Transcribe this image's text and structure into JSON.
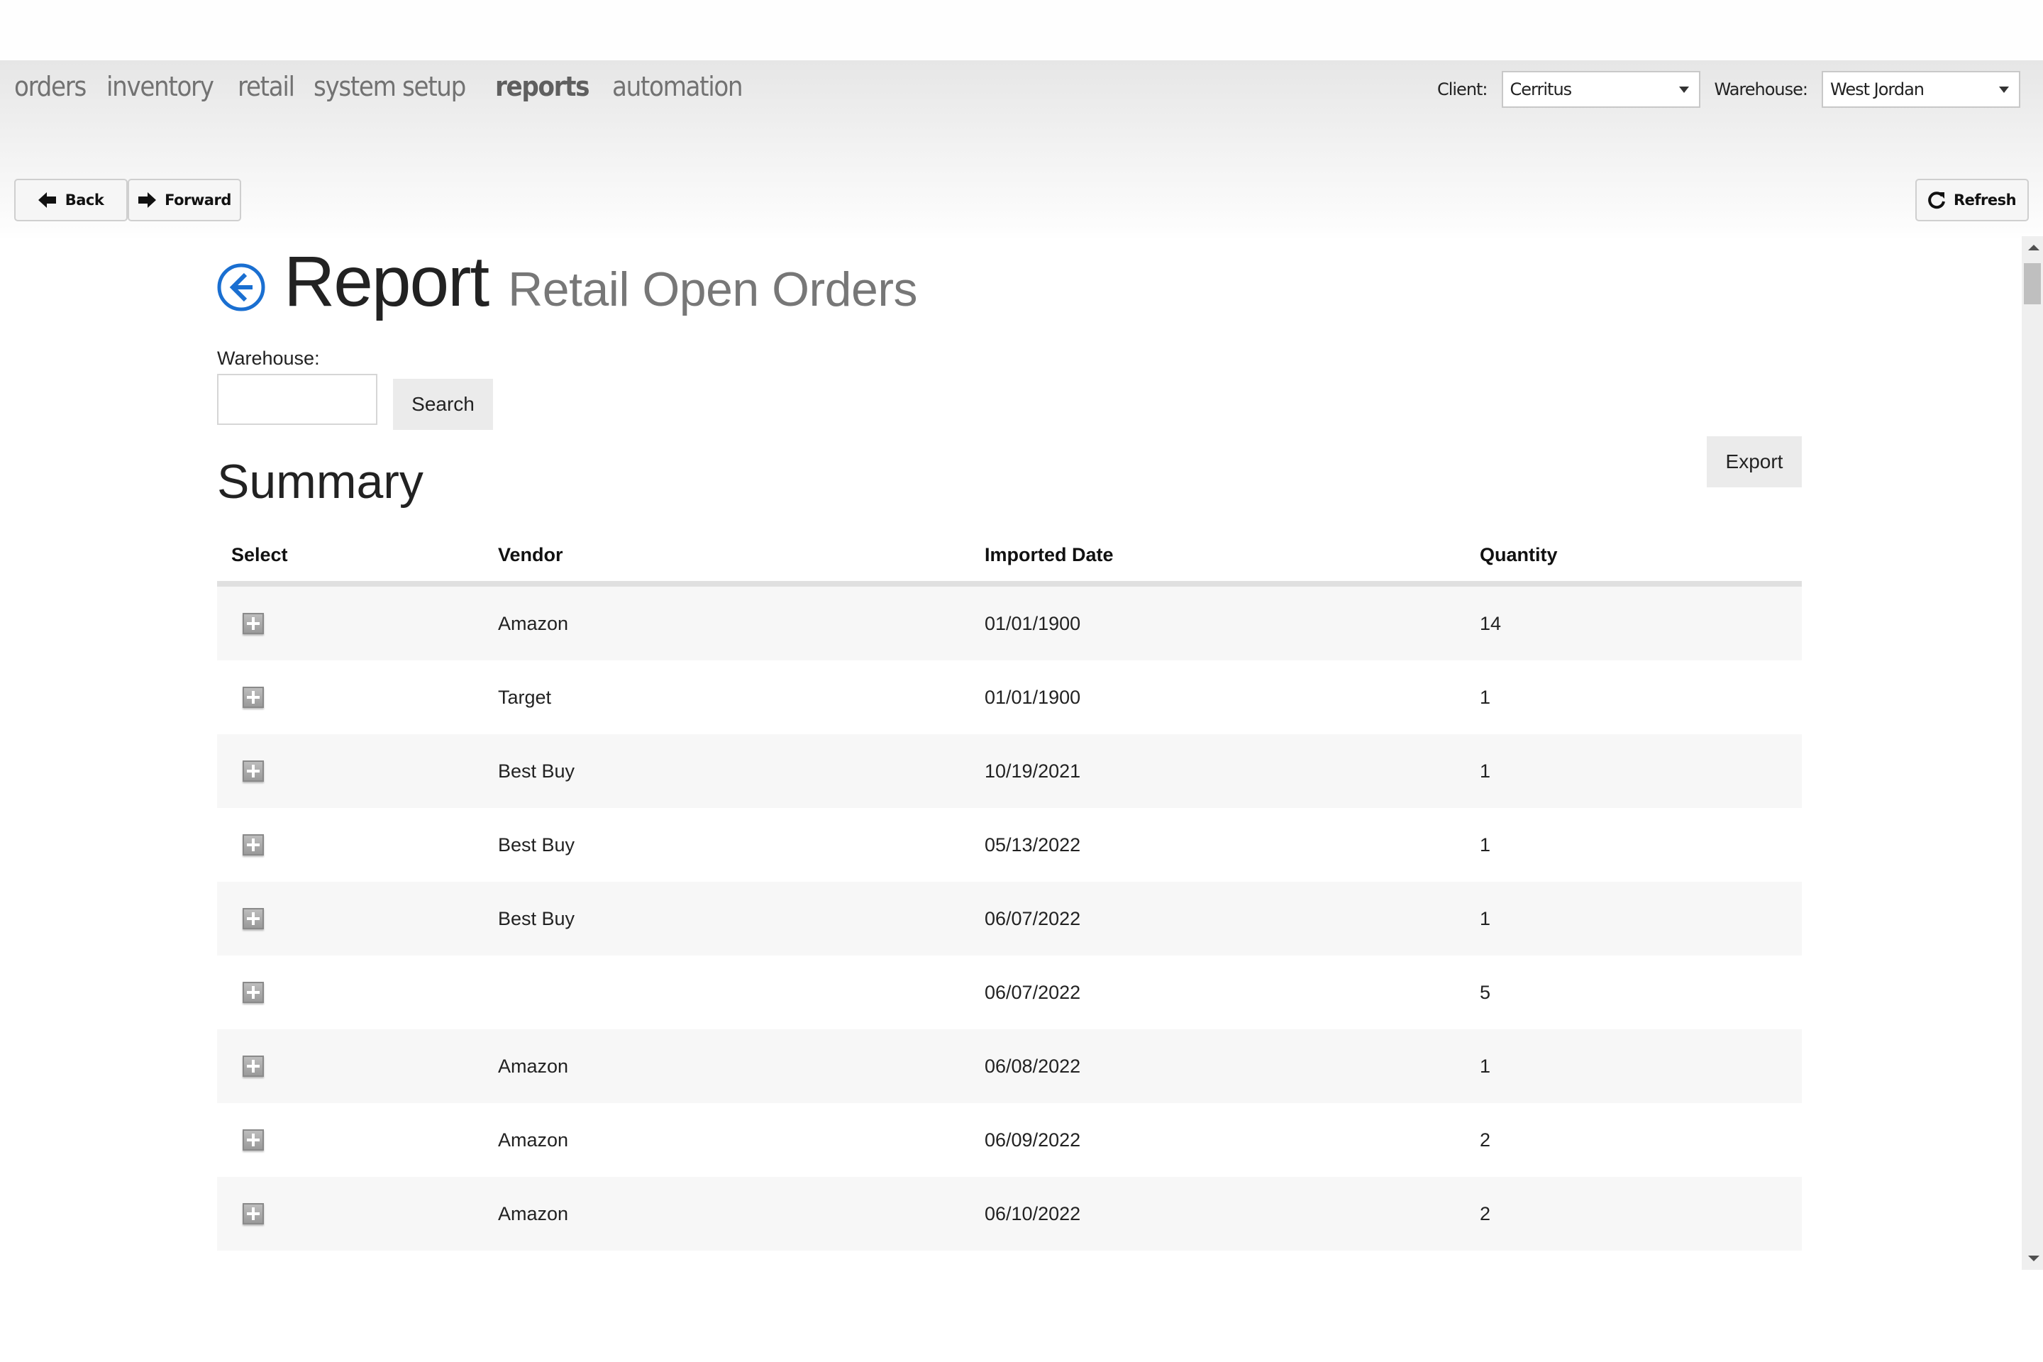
{
  "nav": {
    "items": [
      {
        "label": "orders",
        "active": false
      },
      {
        "label": "inventory",
        "active": false
      },
      {
        "label": "retail",
        "active": false
      },
      {
        "label": "system setup",
        "active": false
      },
      {
        "label": "reports",
        "active": true
      },
      {
        "label": "automation",
        "active": false
      }
    ]
  },
  "selectors": {
    "client_label": "Client:",
    "client_value": "Cerritus",
    "warehouse_label": "Warehouse:",
    "warehouse_value": "West Jordan"
  },
  "toolbar": {
    "back_label": "Back",
    "forward_label": "Forward",
    "refresh_label": "Refresh"
  },
  "page": {
    "title": "Report",
    "subtitle": "Retail Open Orders",
    "accent_color": "#1a6fd1",
    "filter_label": "Warehouse:",
    "filter_value": "",
    "search_label": "Search",
    "export_label": "Export",
    "section_title": "Summary"
  },
  "table": {
    "columns": [
      "Select",
      "Vendor",
      "Imported Date",
      "Quantity"
    ],
    "rows": [
      {
        "vendor": "Amazon",
        "date": "01/01/1900",
        "quantity": "14"
      },
      {
        "vendor": "Target",
        "date": "01/01/1900",
        "quantity": "1"
      },
      {
        "vendor": "Best Buy",
        "date": "10/19/2021",
        "quantity": "1"
      },
      {
        "vendor": "Best Buy",
        "date": "05/13/2022",
        "quantity": "1"
      },
      {
        "vendor": "Best Buy",
        "date": "06/07/2022",
        "quantity": "1"
      },
      {
        "vendor": "",
        "date": "06/07/2022",
        "quantity": "5"
      },
      {
        "vendor": "Amazon",
        "date": "06/08/2022",
        "quantity": "1"
      },
      {
        "vendor": "Amazon",
        "date": "06/09/2022",
        "quantity": "2"
      },
      {
        "vendor": "Amazon",
        "date": "06/10/2022",
        "quantity": "2"
      }
    ]
  },
  "icons": {
    "back": "arrow-left-icon",
    "forward": "arrow-right-icon",
    "refresh": "refresh-icon",
    "title_back": "circle-arrow-left-icon",
    "expand": "plus-square-icon"
  }
}
